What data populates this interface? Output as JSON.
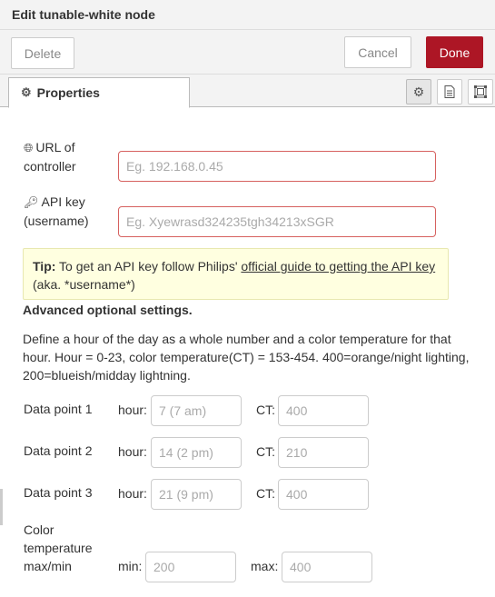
{
  "window": {
    "title": "Edit tunable-white node"
  },
  "toolbar": {
    "delete_label": "Delete",
    "cancel_label": "Cancel",
    "done_label": "Done"
  },
  "tabs": {
    "properties_label": "Properties"
  },
  "form": {
    "url": {
      "label_line1": "URL of",
      "label_line2": "controller",
      "placeholder": "Eg. 192.168.0.45"
    },
    "api": {
      "label_line1": "API key",
      "label_line2": "(username)",
      "placeholder": "Eg. Xyewrasd324235tgh34213xSGR"
    },
    "tip": {
      "bold": "Tip:",
      "text_before": " To get an API key follow Philips' ",
      "link": "official guide to getting the API key",
      "text_after": " (aka. *username*)"
    },
    "advanced_heading": "Advanced optional settings.",
    "description": "Define a hour of the day as a whole number and a color temperature for that hour. Hour = 0-23, color temperature(CT) = 153-454. 400=orange/night lighting, 200=blueish/midday lightning.",
    "hour_label": "hour:",
    "ct_label": "CT:",
    "data_points": [
      {
        "label": "Data point 1",
        "hour_placeholder": "7 (7 am)",
        "ct_placeholder": "400"
      },
      {
        "label": "Data point 2",
        "hour_placeholder": "14 (2 pm)",
        "ct_placeholder": "210"
      },
      {
        "label": "Data point 3",
        "hour_placeholder": "21 (9 pm)",
        "ct_placeholder": "400"
      }
    ],
    "color_temp": {
      "label_line1": "Color",
      "label_line2": "temperature",
      "label_line3": "max/min",
      "min_label": "min:",
      "min_placeholder": "200",
      "max_label": "max:",
      "max_placeholder": "400"
    }
  },
  "colors": {
    "done_button": "#ad1625",
    "error_border": "#d6615f",
    "tip_background": "#ffffe0"
  },
  "icons": {
    "tab": "cog-icon",
    "url": "globe-icon",
    "api": "key-icon"
  }
}
